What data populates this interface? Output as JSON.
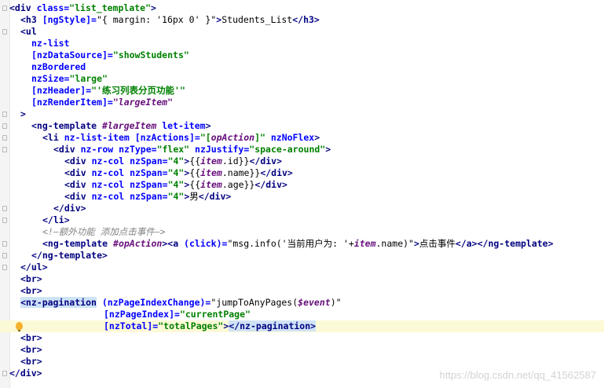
{
  "editor": {
    "lines": [
      {
        "segments": [
          {
            "t": "<div ",
            "c": "tag"
          },
          {
            "t": "class=",
            "c": "attr"
          },
          {
            "t": "\"list_template\"",
            "c": "val"
          },
          {
            "t": ">",
            "c": "tag"
          }
        ]
      },
      {
        "segments": [
          {
            "t": "<h3 ",
            "c": "tag"
          },
          {
            "t": "[ngStyle]=",
            "c": "attr"
          },
          {
            "t": "\"{ margin: '16px 0' }\"",
            "c": "plain"
          },
          {
            "t": ">",
            "c": "tag"
          },
          {
            "t": "Students_List",
            "c": "plain"
          },
          {
            "t": "</h3>",
            "c": "tag"
          }
        ]
      },
      {
        "segments": [
          {
            "t": "<ul",
            "c": "tag"
          }
        ]
      },
      {
        "segments": [
          {
            "t": "nz-list",
            "c": "attr"
          }
        ]
      },
      {
        "segments": [
          {
            "t": "[nzDataSource]=",
            "c": "attr"
          },
          {
            "t": "\"showStudents\"",
            "c": "val"
          }
        ]
      },
      {
        "segments": [
          {
            "t": "nzBordered",
            "c": "attr"
          }
        ]
      },
      {
        "segments": [
          {
            "t": "nzSize=",
            "c": "attr"
          },
          {
            "t": "\"large\"",
            "c": "val"
          }
        ]
      },
      {
        "segments": [
          {
            "t": "[nzHeader]=",
            "c": "attr"
          },
          {
            "t": "\"'练习列表分页功能'\"",
            "c": "val"
          }
        ]
      },
      {
        "segments": [
          {
            "t": "[nzRenderItem]=",
            "c": "attr"
          },
          {
            "t": "\"largeItem\"",
            "c": "ivar"
          }
        ]
      },
      {
        "segments": [
          {
            "t": ">",
            "c": "tag"
          }
        ]
      },
      {
        "segments": [
          {
            "t": "<ng-template ",
            "c": "tag"
          },
          {
            "t": "#largeItem ",
            "c": "ivar"
          },
          {
            "t": "let-item",
            "c": "attr"
          },
          {
            "t": ">",
            "c": "tag"
          }
        ]
      },
      {
        "segments": [
          {
            "t": "<li ",
            "c": "tag"
          },
          {
            "t": "nz-list-item ",
            "c": "attr"
          },
          {
            "t": "[nzActions]=",
            "c": "attr"
          },
          {
            "t": "\"[",
            "c": "val"
          },
          {
            "t": "opAction",
            "c": "ivar"
          },
          {
            "t": "]\" ",
            "c": "val"
          },
          {
            "t": "nzNoFlex",
            "c": "attr"
          },
          {
            "t": ">",
            "c": "tag"
          }
        ]
      },
      {
        "segments": [
          {
            "t": "<div ",
            "c": "tag"
          },
          {
            "t": "nz-row ",
            "c": "attr"
          },
          {
            "t": "nzType=",
            "c": "attr"
          },
          {
            "t": "\"flex\" ",
            "c": "val"
          },
          {
            "t": "nzJustify=",
            "c": "attr"
          },
          {
            "t": "\"space-around\"",
            "c": "val"
          },
          {
            "t": ">",
            "c": "tag"
          }
        ]
      },
      {
        "segments": [
          {
            "t": "<div ",
            "c": "tag"
          },
          {
            "t": "nz-col ",
            "c": "attr"
          },
          {
            "t": "nzSpan=",
            "c": "attr"
          },
          {
            "t": "\"4\"",
            "c": "val"
          },
          {
            "t": ">",
            "c": "tag"
          },
          {
            "t": "{{",
            "c": "plain"
          },
          {
            "t": "item",
            "c": "ivar"
          },
          {
            "t": ".id}}",
            "c": "plain"
          },
          {
            "t": "</div>",
            "c": "tag"
          }
        ]
      },
      {
        "segments": [
          {
            "t": "<div ",
            "c": "tag"
          },
          {
            "t": "nz-col ",
            "c": "attr"
          },
          {
            "t": "nzSpan=",
            "c": "attr"
          },
          {
            "t": "\"4\"",
            "c": "val"
          },
          {
            "t": ">",
            "c": "tag"
          },
          {
            "t": "{{",
            "c": "plain"
          },
          {
            "t": "item",
            "c": "ivar"
          },
          {
            "t": ".name}}",
            "c": "plain"
          },
          {
            "t": "</div>",
            "c": "tag"
          }
        ]
      },
      {
        "segments": [
          {
            "t": "<div ",
            "c": "tag"
          },
          {
            "t": "nz-col ",
            "c": "attr"
          },
          {
            "t": "nzSpan=",
            "c": "attr"
          },
          {
            "t": "\"4\"",
            "c": "val"
          },
          {
            "t": ">",
            "c": "tag"
          },
          {
            "t": "{{",
            "c": "plain"
          },
          {
            "t": "item",
            "c": "ivar"
          },
          {
            "t": ".age}}",
            "c": "plain"
          },
          {
            "t": "</div>",
            "c": "tag"
          }
        ]
      },
      {
        "segments": [
          {
            "t": "<div ",
            "c": "tag"
          },
          {
            "t": "nz-col ",
            "c": "attr"
          },
          {
            "t": "nzSpan=",
            "c": "attr"
          },
          {
            "t": "\"4\"",
            "c": "val"
          },
          {
            "t": ">",
            "c": "tag"
          },
          {
            "t": "男",
            "c": "plain"
          },
          {
            "t": "</div>",
            "c": "tag"
          }
        ]
      },
      {
        "segments": [
          {
            "t": "</div>",
            "c": "tag"
          }
        ]
      },
      {
        "segments": [
          {
            "t": "</li>",
            "c": "tag"
          }
        ]
      },
      {
        "segments": [
          {
            "t": "<!—额外功能 添加点击事件—>",
            "c": "comment"
          }
        ]
      },
      {
        "segments": [
          {
            "t": "<ng-template ",
            "c": "tag"
          },
          {
            "t": "#opAction",
            "c": "ivar"
          },
          {
            "t": ">",
            "c": "tag"
          },
          {
            "t": "<a ",
            "c": "tag"
          },
          {
            "t": "(click)=",
            "c": "attr"
          },
          {
            "t": "\"msg.info('当前用户为: '+",
            "c": "plain"
          },
          {
            "t": "item",
            "c": "ivar"
          },
          {
            "t": ".name)\"",
            "c": "plain"
          },
          {
            "t": ">",
            "c": "tag"
          },
          {
            "t": "点击事件",
            "c": "plain"
          },
          {
            "t": "</a></ng-template>",
            "c": "tag"
          }
        ]
      },
      {
        "segments": [
          {
            "t": "</ng-template>",
            "c": "tag"
          }
        ]
      },
      {
        "segments": [
          {
            "t": "</ul>",
            "c": "tag"
          }
        ]
      },
      {
        "segments": [
          {
            "t": "<br>",
            "c": "tag"
          }
        ]
      },
      {
        "segments": [
          {
            "t": "<br>",
            "c": "tag"
          }
        ]
      },
      {
        "segments": [
          {
            "t": "<nz-pagination",
            "c": "tag",
            "hl": true
          },
          {
            "t": " ",
            "c": "plain"
          },
          {
            "t": "(nzPageIndexChange)=",
            "c": "attr"
          },
          {
            "t": "\"jumpToAnyPages(",
            "c": "plain"
          },
          {
            "t": "$event",
            "c": "ivar"
          },
          {
            "t": ")\"",
            "c": "plain"
          }
        ]
      },
      {
        "segments": [
          {
            "t": "[nzPageIndex]=",
            "c": "attr"
          },
          {
            "t": "\"currentPage\"",
            "c": "val"
          }
        ]
      },
      {
        "segments": [
          {
            "t": "[nzTotal]=",
            "c": "attr"
          },
          {
            "t": "\"totalPages\"",
            "c": "val"
          },
          {
            "t": ">",
            "c": "tag"
          },
          {
            "t": "</nz-pagination>",
            "c": "tag",
            "hl": true
          }
        ]
      },
      {
        "segments": [
          {
            "t": "<br>",
            "c": "tag"
          }
        ]
      },
      {
        "segments": [
          {
            "t": "<br>",
            "c": "tag"
          }
        ]
      },
      {
        "segments": [
          {
            "t": "<br>",
            "c": "tag"
          }
        ]
      },
      {
        "segments": [
          {
            "t": "</div>",
            "c": "tag"
          }
        ]
      }
    ]
  },
  "colors": {
    "tag": "#000080",
    "attribute": "#0000ff",
    "string": "#008000",
    "variable": "#660e7a",
    "comment": "#808080",
    "current_line": "#fcf9d6",
    "tag_match": "#cfe3f6"
  },
  "icons": {
    "intention": "lightbulb-icon"
  },
  "watermark": "https://blog.csdn.net/qq_41562587"
}
